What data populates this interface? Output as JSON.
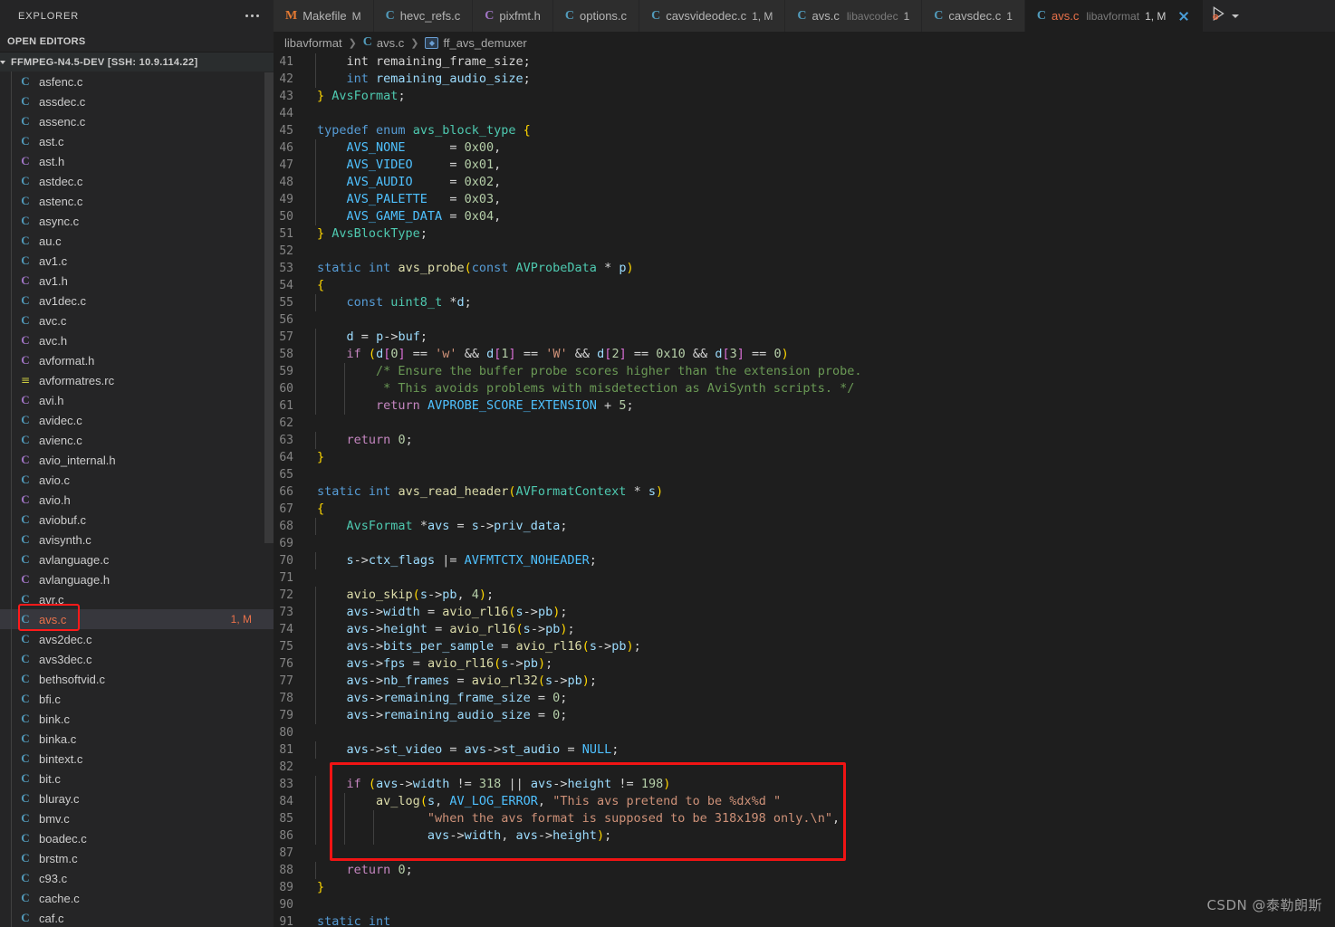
{
  "sidebar": {
    "title": "EXPLORER",
    "menu_icon": "ellipsis-icon",
    "open_editors_label": "OPEN EDITORS",
    "project_label": "FFMPEG-N4.5-DEV [SSH: 10.9.114.22]",
    "files": [
      {
        "name": "asfenc.c",
        "icon": "c-blue"
      },
      {
        "name": "assdec.c",
        "icon": "c-blue"
      },
      {
        "name": "assenc.c",
        "icon": "c-blue"
      },
      {
        "name": "ast.c",
        "icon": "c-blue"
      },
      {
        "name": "ast.h",
        "icon": "c-purple"
      },
      {
        "name": "astdec.c",
        "icon": "c-blue"
      },
      {
        "name": "astenc.c",
        "icon": "c-blue"
      },
      {
        "name": "async.c",
        "icon": "c-blue"
      },
      {
        "name": "au.c",
        "icon": "c-blue"
      },
      {
        "name": "av1.c",
        "icon": "c-blue"
      },
      {
        "name": "av1.h",
        "icon": "c-purple"
      },
      {
        "name": "av1dec.c",
        "icon": "c-blue"
      },
      {
        "name": "avc.c",
        "icon": "c-blue"
      },
      {
        "name": "avc.h",
        "icon": "c-purple"
      },
      {
        "name": "avformat.h",
        "icon": "c-purple"
      },
      {
        "name": "avformatres.rc",
        "icon": "rc"
      },
      {
        "name": "avi.h",
        "icon": "c-purple"
      },
      {
        "name": "avidec.c",
        "icon": "c-blue"
      },
      {
        "name": "avienc.c",
        "icon": "c-blue"
      },
      {
        "name": "avio_internal.h",
        "icon": "c-purple"
      },
      {
        "name": "avio.c",
        "icon": "c-blue"
      },
      {
        "name": "avio.h",
        "icon": "c-purple"
      },
      {
        "name": "aviobuf.c",
        "icon": "c-blue"
      },
      {
        "name": "avisynth.c",
        "icon": "c-blue"
      },
      {
        "name": "avlanguage.c",
        "icon": "c-blue"
      },
      {
        "name": "avlanguage.h",
        "icon": "c-purple"
      },
      {
        "name": "avr.c",
        "icon": "c-blue"
      },
      {
        "name": "avs.c",
        "icon": "c-blue",
        "selected": true,
        "badge": "1, M"
      },
      {
        "name": "avs2dec.c",
        "icon": "c-blue"
      },
      {
        "name": "avs3dec.c",
        "icon": "c-blue"
      },
      {
        "name": "bethsoftvid.c",
        "icon": "c-blue"
      },
      {
        "name": "bfi.c",
        "icon": "c-blue"
      },
      {
        "name": "bink.c",
        "icon": "c-blue"
      },
      {
        "name": "binka.c",
        "icon": "c-blue"
      },
      {
        "name": "bintext.c",
        "icon": "c-blue"
      },
      {
        "name": "bit.c",
        "icon": "c-blue"
      },
      {
        "name": "bluray.c",
        "icon": "c-blue"
      },
      {
        "name": "bmv.c",
        "icon": "c-blue"
      },
      {
        "name": "boadec.c",
        "icon": "c-blue"
      },
      {
        "name": "brstm.c",
        "icon": "c-blue"
      },
      {
        "name": "c93.c",
        "icon": "c-blue"
      },
      {
        "name": "cache.c",
        "icon": "c-blue"
      },
      {
        "name": "caf.c",
        "icon": "c-blue"
      }
    ]
  },
  "tabs": [
    {
      "label": "Makefile",
      "desc": "",
      "badge": "M",
      "icon": "M",
      "icon_color": "orange",
      "active": false
    },
    {
      "label": "hevc_refs.c",
      "desc": "",
      "badge": "",
      "icon": "C",
      "icon_color": "blue",
      "active": false
    },
    {
      "label": "pixfmt.h",
      "desc": "",
      "badge": "",
      "icon": "C",
      "icon_color": "purple",
      "active": false
    },
    {
      "label": "options.c",
      "desc": "",
      "badge": "",
      "icon": "C",
      "icon_color": "blue",
      "active": false
    },
    {
      "label": "cavsvideodec.c",
      "desc": "",
      "badge": "1, M",
      "icon": "C",
      "icon_color": "blue",
      "active": false
    },
    {
      "label": "avs.c",
      "desc": "libavcodec",
      "badge": "1",
      "icon": "C",
      "icon_color": "blue",
      "active": false
    },
    {
      "label": "cavsdec.c",
      "desc": "",
      "badge": "1",
      "icon": "C",
      "icon_color": "blue",
      "active": false
    },
    {
      "label": "avs.c",
      "desc": "libavformat",
      "badge": "1, M",
      "icon": "C",
      "icon_color": "blue",
      "active": true,
      "close": "close-icon"
    }
  ],
  "tab_actions": {
    "run_label": "run-and-debug-icon",
    "chevron": "chevron-down-icon"
  },
  "breadcrumb": {
    "folder": "libavformat",
    "file": "avs.c",
    "symbol": "ff_avs_demuxer",
    "file_icon": "C",
    "symbol_icon": "variable-symbol-icon"
  },
  "code": {
    "first_line": 41,
    "lines": [
      {
        "n": 41,
        "html": "<span class='op'>    int</span> <span class='op'>remaining_frame_size;</span>",
        "indent": 1
      },
      {
        "n": 42,
        "html": "    <span class='k'>int</span> <span class='var'>remaining_audio_size</span><span class='op'>;</span>",
        "indent": 1
      },
      {
        "n": 43,
        "html": "<span class='br1'>}</span> <span class='ty'>AvsFormat</span><span class='op'>;</span>",
        "indent": 0
      },
      {
        "n": 44,
        "html": "",
        "indent": 0
      },
      {
        "n": 45,
        "html": "<span class='k'>typedef</span> <span class='k'>enum</span> <span class='ty'>avs_block_type</span> <span class='br1'>{</span>",
        "indent": 0
      },
      {
        "n": 46,
        "html": "    <span class='cst'>AVS_NONE</span>      <span class='op'>=</span> <span class='num'>0x00</span><span class='op'>,</span>",
        "indent": 1
      },
      {
        "n": 47,
        "html": "    <span class='cst'>AVS_VIDEO</span>     <span class='op'>=</span> <span class='num'>0x01</span><span class='op'>,</span>",
        "indent": 1
      },
      {
        "n": 48,
        "html": "    <span class='cst'>AVS_AUDIO</span>     <span class='op'>=</span> <span class='num'>0x02</span><span class='op'>,</span>",
        "indent": 1
      },
      {
        "n": 49,
        "html": "    <span class='cst'>AVS_PALETTE</span>   <span class='op'>=</span> <span class='num'>0x03</span><span class='op'>,</span>",
        "indent": 1
      },
      {
        "n": 50,
        "html": "    <span class='cst'>AVS_GAME_DATA</span> <span class='op'>=</span> <span class='num'>0x04</span><span class='op'>,</span>",
        "indent": 1
      },
      {
        "n": 51,
        "html": "<span class='br1'>}</span> <span class='ty'>AvsBlockType</span><span class='op'>;</span>",
        "indent": 0
      },
      {
        "n": 52,
        "html": "",
        "indent": 0
      },
      {
        "n": 53,
        "html": "<span class='k'>static</span> <span class='k'>int</span> <span class='fn'>avs_probe</span><span class='br1'>(</span><span class='k'>const</span> <span class='ty'>AVProbeData</span> <span class='op'>*</span> <span class='var'>p</span><span class='br1'>)</span>",
        "indent": 0
      },
      {
        "n": 54,
        "html": "<span class='br1'>{</span>",
        "indent": 0
      },
      {
        "n": 55,
        "html": "    <span class='k'>const</span> <span class='ty'>uint8_t</span> <span class='op'>*</span><span class='var'>d</span><span class='op'>;</span>",
        "indent": 1
      },
      {
        "n": 56,
        "html": "",
        "indent": 1
      },
      {
        "n": 57,
        "html": "    <span class='var'>d</span> <span class='op'>=</span> <span class='var'>p</span><span class='op'>-&gt;</span><span class='var'>buf</span><span class='op'>;</span>",
        "indent": 1
      },
      {
        "n": 58,
        "html": "    <span class='kc'>if</span> <span class='br1'>(</span><span class='var'>d</span><span class='br2'>[</span><span class='num'>0</span><span class='br2'>]</span> <span class='op'>==</span> <span class='str'>'w'</span> <span class='op'>&amp;&amp;</span> <span class='var'>d</span><span class='br2'>[</span><span class='num'>1</span><span class='br2'>]</span> <span class='op'>==</span> <span class='str'>'W'</span> <span class='op'>&amp;&amp;</span> <span class='var'>d</span><span class='br2'>[</span><span class='num'>2</span><span class='br2'>]</span> <span class='op'>==</span> <span class='num'>0x10</span> <span class='op'>&amp;&amp;</span> <span class='var'>d</span><span class='br2'>[</span><span class='num'>3</span><span class='br2'>]</span> <span class='op'>==</span> <span class='num'>0</span><span class='br1'>)</span>",
        "indent": 1
      },
      {
        "n": 59,
        "html": "        <span class='cmt'>/* Ensure the buffer probe scores higher than the extension probe.</span>",
        "indent": 2
      },
      {
        "n": 60,
        "html": "         <span class='cmt'>* This avoids problems with misdetection as AviSynth scripts. */</span>",
        "indent": 2
      },
      {
        "n": 61,
        "html": "        <span class='kc'>return</span> <span class='cst'>AVPROBE_SCORE_EXTENSION</span> <span class='op'>+</span> <span class='num'>5</span><span class='op'>;</span>",
        "indent": 2
      },
      {
        "n": 62,
        "html": "",
        "indent": 1
      },
      {
        "n": 63,
        "html": "    <span class='kc'>return</span> <span class='num'>0</span><span class='op'>;</span>",
        "indent": 1
      },
      {
        "n": 64,
        "html": "<span class='br1'>}</span>",
        "indent": 0
      },
      {
        "n": 65,
        "html": "",
        "indent": 0
      },
      {
        "n": 66,
        "html": "<span class='k'>static</span> <span class='k'>int</span> <span class='fn'>avs_read_header</span><span class='br1'>(</span><span class='ty'>AVFormatContext</span> <span class='op'>*</span> <span class='var'>s</span><span class='br1'>)</span>",
        "indent": 0
      },
      {
        "n": 67,
        "html": "<span class='br1'>{</span>",
        "indent": 0
      },
      {
        "n": 68,
        "html": "    <span class='ty'>AvsFormat</span> <span class='op'>*</span><span class='var'>avs</span> <span class='op'>=</span> <span class='var'>s</span><span class='op'>-&gt;</span><span class='var'>priv_data</span><span class='op'>;</span>",
        "indent": 1
      },
      {
        "n": 69,
        "html": "",
        "indent": 1
      },
      {
        "n": 70,
        "html": "    <span class='var'>s</span><span class='op'>-&gt;</span><span class='var'>ctx_flags</span> <span class='op'>|=</span> <span class='cst'>AVFMTCTX_NOHEADER</span><span class='op'>;</span>",
        "indent": 1
      },
      {
        "n": 71,
        "html": "",
        "indent": 1
      },
      {
        "n": 72,
        "html": "    <span class='fn'>avio_skip</span><span class='br1'>(</span><span class='var'>s</span><span class='op'>-&gt;</span><span class='var'>pb</span><span class='op'>,</span> <span class='num'>4</span><span class='br1'>)</span><span class='op'>;</span>",
        "indent": 1
      },
      {
        "n": 73,
        "html": "    <span class='var'>avs</span><span class='op'>-&gt;</span><span class='var'>width</span> <span class='op'>=</span> <span class='fn'>avio_rl16</span><span class='br1'>(</span><span class='var'>s</span><span class='op'>-&gt;</span><span class='var'>pb</span><span class='br1'>)</span><span class='op'>;</span>",
        "indent": 1
      },
      {
        "n": 74,
        "html": "    <span class='var'>avs</span><span class='op'>-&gt;</span><span class='var'>height</span> <span class='op'>=</span> <span class='fn'>avio_rl16</span><span class='br1'>(</span><span class='var'>s</span><span class='op'>-&gt;</span><span class='var'>pb</span><span class='br1'>)</span><span class='op'>;</span>",
        "indent": 1
      },
      {
        "n": 75,
        "html": "    <span class='var'>avs</span><span class='op'>-&gt;</span><span class='var'>bits_per_sample</span> <span class='op'>=</span> <span class='fn'>avio_rl16</span><span class='br1'>(</span><span class='var'>s</span><span class='op'>-&gt;</span><span class='var'>pb</span><span class='br1'>)</span><span class='op'>;</span>",
        "indent": 1
      },
      {
        "n": 76,
        "html": "    <span class='var'>avs</span><span class='op'>-&gt;</span><span class='var'>fps</span> <span class='op'>=</span> <span class='fn'>avio_rl16</span><span class='br1'>(</span><span class='var'>s</span><span class='op'>-&gt;</span><span class='var'>pb</span><span class='br1'>)</span><span class='op'>;</span>",
        "indent": 1
      },
      {
        "n": 77,
        "html": "    <span class='var'>avs</span><span class='op'>-&gt;</span><span class='var'>nb_frames</span> <span class='op'>=</span> <span class='fn'>avio_rl32</span><span class='br1'>(</span><span class='var'>s</span><span class='op'>-&gt;</span><span class='var'>pb</span><span class='br1'>)</span><span class='op'>;</span>",
        "indent": 1
      },
      {
        "n": 78,
        "html": "    <span class='var'>avs</span><span class='op'>-&gt;</span><span class='var'>remaining_frame_size</span> <span class='op'>=</span> <span class='num'>0</span><span class='op'>;</span>",
        "indent": 1
      },
      {
        "n": 79,
        "html": "    <span class='var'>avs</span><span class='op'>-&gt;</span><span class='var'>remaining_audio_size</span> <span class='op'>=</span> <span class='num'>0</span><span class='op'>;</span>",
        "indent": 1
      },
      {
        "n": 80,
        "html": "",
        "indent": 1
      },
      {
        "n": 81,
        "html": "    <span class='var'>avs</span><span class='op'>-&gt;</span><span class='var'>st_video</span> <span class='op'>=</span> <span class='var'>avs</span><span class='op'>-&gt;</span><span class='var'>st_audio</span> <span class='op'>=</span> <span class='cst'>NULL</span><span class='op'>;</span>",
        "indent": 1
      },
      {
        "n": 82,
        "html": "",
        "indent": 1
      },
      {
        "n": 83,
        "html": "    <span class='kc'>if</span> <span class='br1'>(</span><span class='var'>avs</span><span class='op'>-&gt;</span><span class='var'>width</span> <span class='op'>!=</span> <span class='num'>318</span> <span class='op'>||</span> <span class='var'>avs</span><span class='op'>-&gt;</span><span class='var'>height</span> <span class='op'>!=</span> <span class='num'>198</span><span class='br1'>)</span>",
        "indent": 1
      },
      {
        "n": 84,
        "html": "        <span class='fn'>av_log</span><span class='br1'>(</span><span class='var'>s</span><span class='op'>,</span> <span class='cst'>AV_LOG_ERROR</span><span class='op'>,</span> <span class='str'>\"This avs pretend to be %dx%d \"</span>",
        "indent": 2
      },
      {
        "n": 85,
        "html": "               <span class='str'>\"when the avs format is supposed to be 318x198 only.\\n\"</span><span class='op'>,</span>",
        "indent": 3
      },
      {
        "n": 86,
        "html": "               <span class='var'>avs</span><span class='op'>-&gt;</span><span class='var'>width</span><span class='op'>,</span> <span class='var'>avs</span><span class='op'>-&gt;</span><span class='var'>height</span><span class='br1'>)</span><span class='op'>;</span>",
        "indent": 3
      },
      {
        "n": 87,
        "html": "",
        "indent": 1
      },
      {
        "n": 88,
        "html": "    <span class='kc'>return</span> <span class='num'>0</span><span class='op'>;</span>",
        "indent": 1
      },
      {
        "n": 89,
        "html": "<span class='br1'>}</span>",
        "indent": 0
      },
      {
        "n": 90,
        "html": "",
        "indent": 0
      },
      {
        "n": 91,
        "html": "<span class='k'>static</span> <span class='k'>int</span>",
        "indent": 0
      }
    ],
    "highlight_box": {
      "from_line": 82,
      "to_line": 87,
      "color": "#f01414"
    }
  },
  "watermark": "CSDN @泰勒朗斯"
}
